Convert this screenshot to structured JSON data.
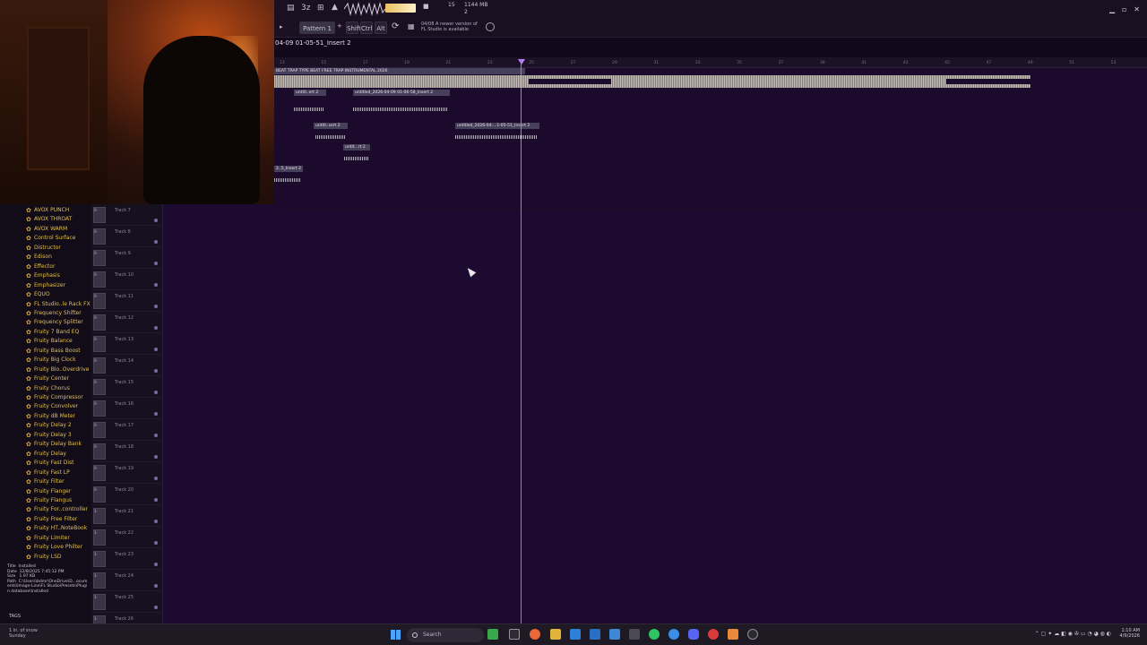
{
  "toolbar": {
    "tempo_label": "3z",
    "pattern_label": "Pattern 1",
    "keys": [
      "Shift",
      "Ctrl",
      "Alt"
    ],
    "cpu_line1": "15",
    "cpu_line2": "1144 MB",
    "cpu_line3": "2",
    "notice_line1": "04/08  A newer version of",
    "notice_line2": "FL Studio is available"
  },
  "playlist": {
    "title": "04-09 01-05-51_Insert 2",
    "ruler_ticks": [
      "13",
      "15",
      "17",
      "19",
      "21",
      "23",
      "25",
      "27",
      "29",
      "31",
      "33",
      "35",
      "37",
      "39",
      "41",
      "43",
      "45",
      "47",
      "49",
      "51",
      "53"
    ],
    "clips": [
      {
        "label": "BEAT TRAP TYPE BEAT FREE TRAP INSTRUMENTAL 2026"
      },
      {
        "label": "untitl..ert 2"
      },
      {
        "label": "untitled_2026-04-09 01-06-58_Insert 2"
      },
      {
        "label": "untitl..sert 2"
      },
      {
        "label": "untitled_2026-04-...1-05-51_Insert 2"
      },
      {
        "label": "untit...rt 2"
      },
      {
        "label": "2..5_Insert 2"
      }
    ]
  },
  "browser": {
    "plugins": [
      "AVOX PUNCH",
      "AVOX THROAT",
      "AVOX WARM",
      "Control Surface",
      "Distructor",
      "Edison",
      "Effector",
      "Emphasis",
      "Emphasizer",
      "EQUO",
      "FL Studio..le Rack FX",
      "Frequency Shifter",
      "Frequency Splitter",
      "Fruity 7 Band EQ",
      "Fruity Balance",
      "Fruity Bass Boost",
      "Fruity Big Clock",
      "Fruity Blo..Overdrive",
      "Fruity Center",
      "Fruity Chorus",
      "Fruity Compressor",
      "Fruity Convolver",
      "Fruity dB Meter",
      "Fruity Delay 2",
      "Fruity Delay 3",
      "Fruity Delay Bank",
      "Fruity Delay",
      "Fruity Fast Dist",
      "Fruity Fast LP",
      "Fruity Filter",
      "Fruity Flanger",
      "Fruity Flangus",
      "Fruity For..controller",
      "Fruity Free Filter",
      "Fruity HT..NoteBook",
      "Fruity Limiter",
      "Fruity Love Philter",
      "Fruity LSD"
    ],
    "file_info": {
      "title_label": "Title",
      "title_value": "Installed",
      "date_label": "Date",
      "date_value": "12/8/2025 7:45:12 PM",
      "size_label": "Size",
      "size_value": "1.97 KB",
      "path_label": "Path",
      "path_value": "C:\\Users\\bdmr\\OneDrive\\D...ocuments\\Image-Line\\FL Studio\\Presets\\Plugin database\\Installed"
    },
    "tags_label": "TAGS"
  },
  "tracks": [
    {
      "name": "Track 7",
      "meter": "0-"
    },
    {
      "name": "Track 8",
      "meter": "0-"
    },
    {
      "name": "Track 9",
      "meter": "0-"
    },
    {
      "name": "Track 10",
      "meter": "0-"
    },
    {
      "name": "Track 11",
      "meter": "0-"
    },
    {
      "name": "Track 12",
      "meter": "0-"
    },
    {
      "name": "Track 13",
      "meter": "0-"
    },
    {
      "name": "Track 14",
      "meter": "0-"
    },
    {
      "name": "Track 15",
      "meter": "0-"
    },
    {
      "name": "Track 16",
      "meter": "0-"
    },
    {
      "name": "Track 17",
      "meter": "0-"
    },
    {
      "name": "Track 18",
      "meter": "0-"
    },
    {
      "name": "Track 19",
      "meter": "0-"
    },
    {
      "name": "Track 20",
      "meter": "0-"
    },
    {
      "name": "Track 21",
      "meter": "1-"
    },
    {
      "name": "Track 22",
      "meter": "1-"
    },
    {
      "name": "Track 23",
      "meter": "1-"
    },
    {
      "name": "Track 24",
      "meter": "1-"
    },
    {
      "name": "Track 25",
      "meter": "1-"
    },
    {
      "name": "Track 26",
      "meter": "1-"
    }
  ],
  "taskbar": {
    "weather_line1": "1 in. of snow",
    "weather_line2": "Sunday",
    "search_placeholder": "Search",
    "time": "1:10 AM",
    "date": "4/9/2026"
  },
  "colors": {
    "playhead": "#b06cff",
    "plugin_text": "#e0c04a",
    "playlist_bg": "#1d0a30"
  }
}
